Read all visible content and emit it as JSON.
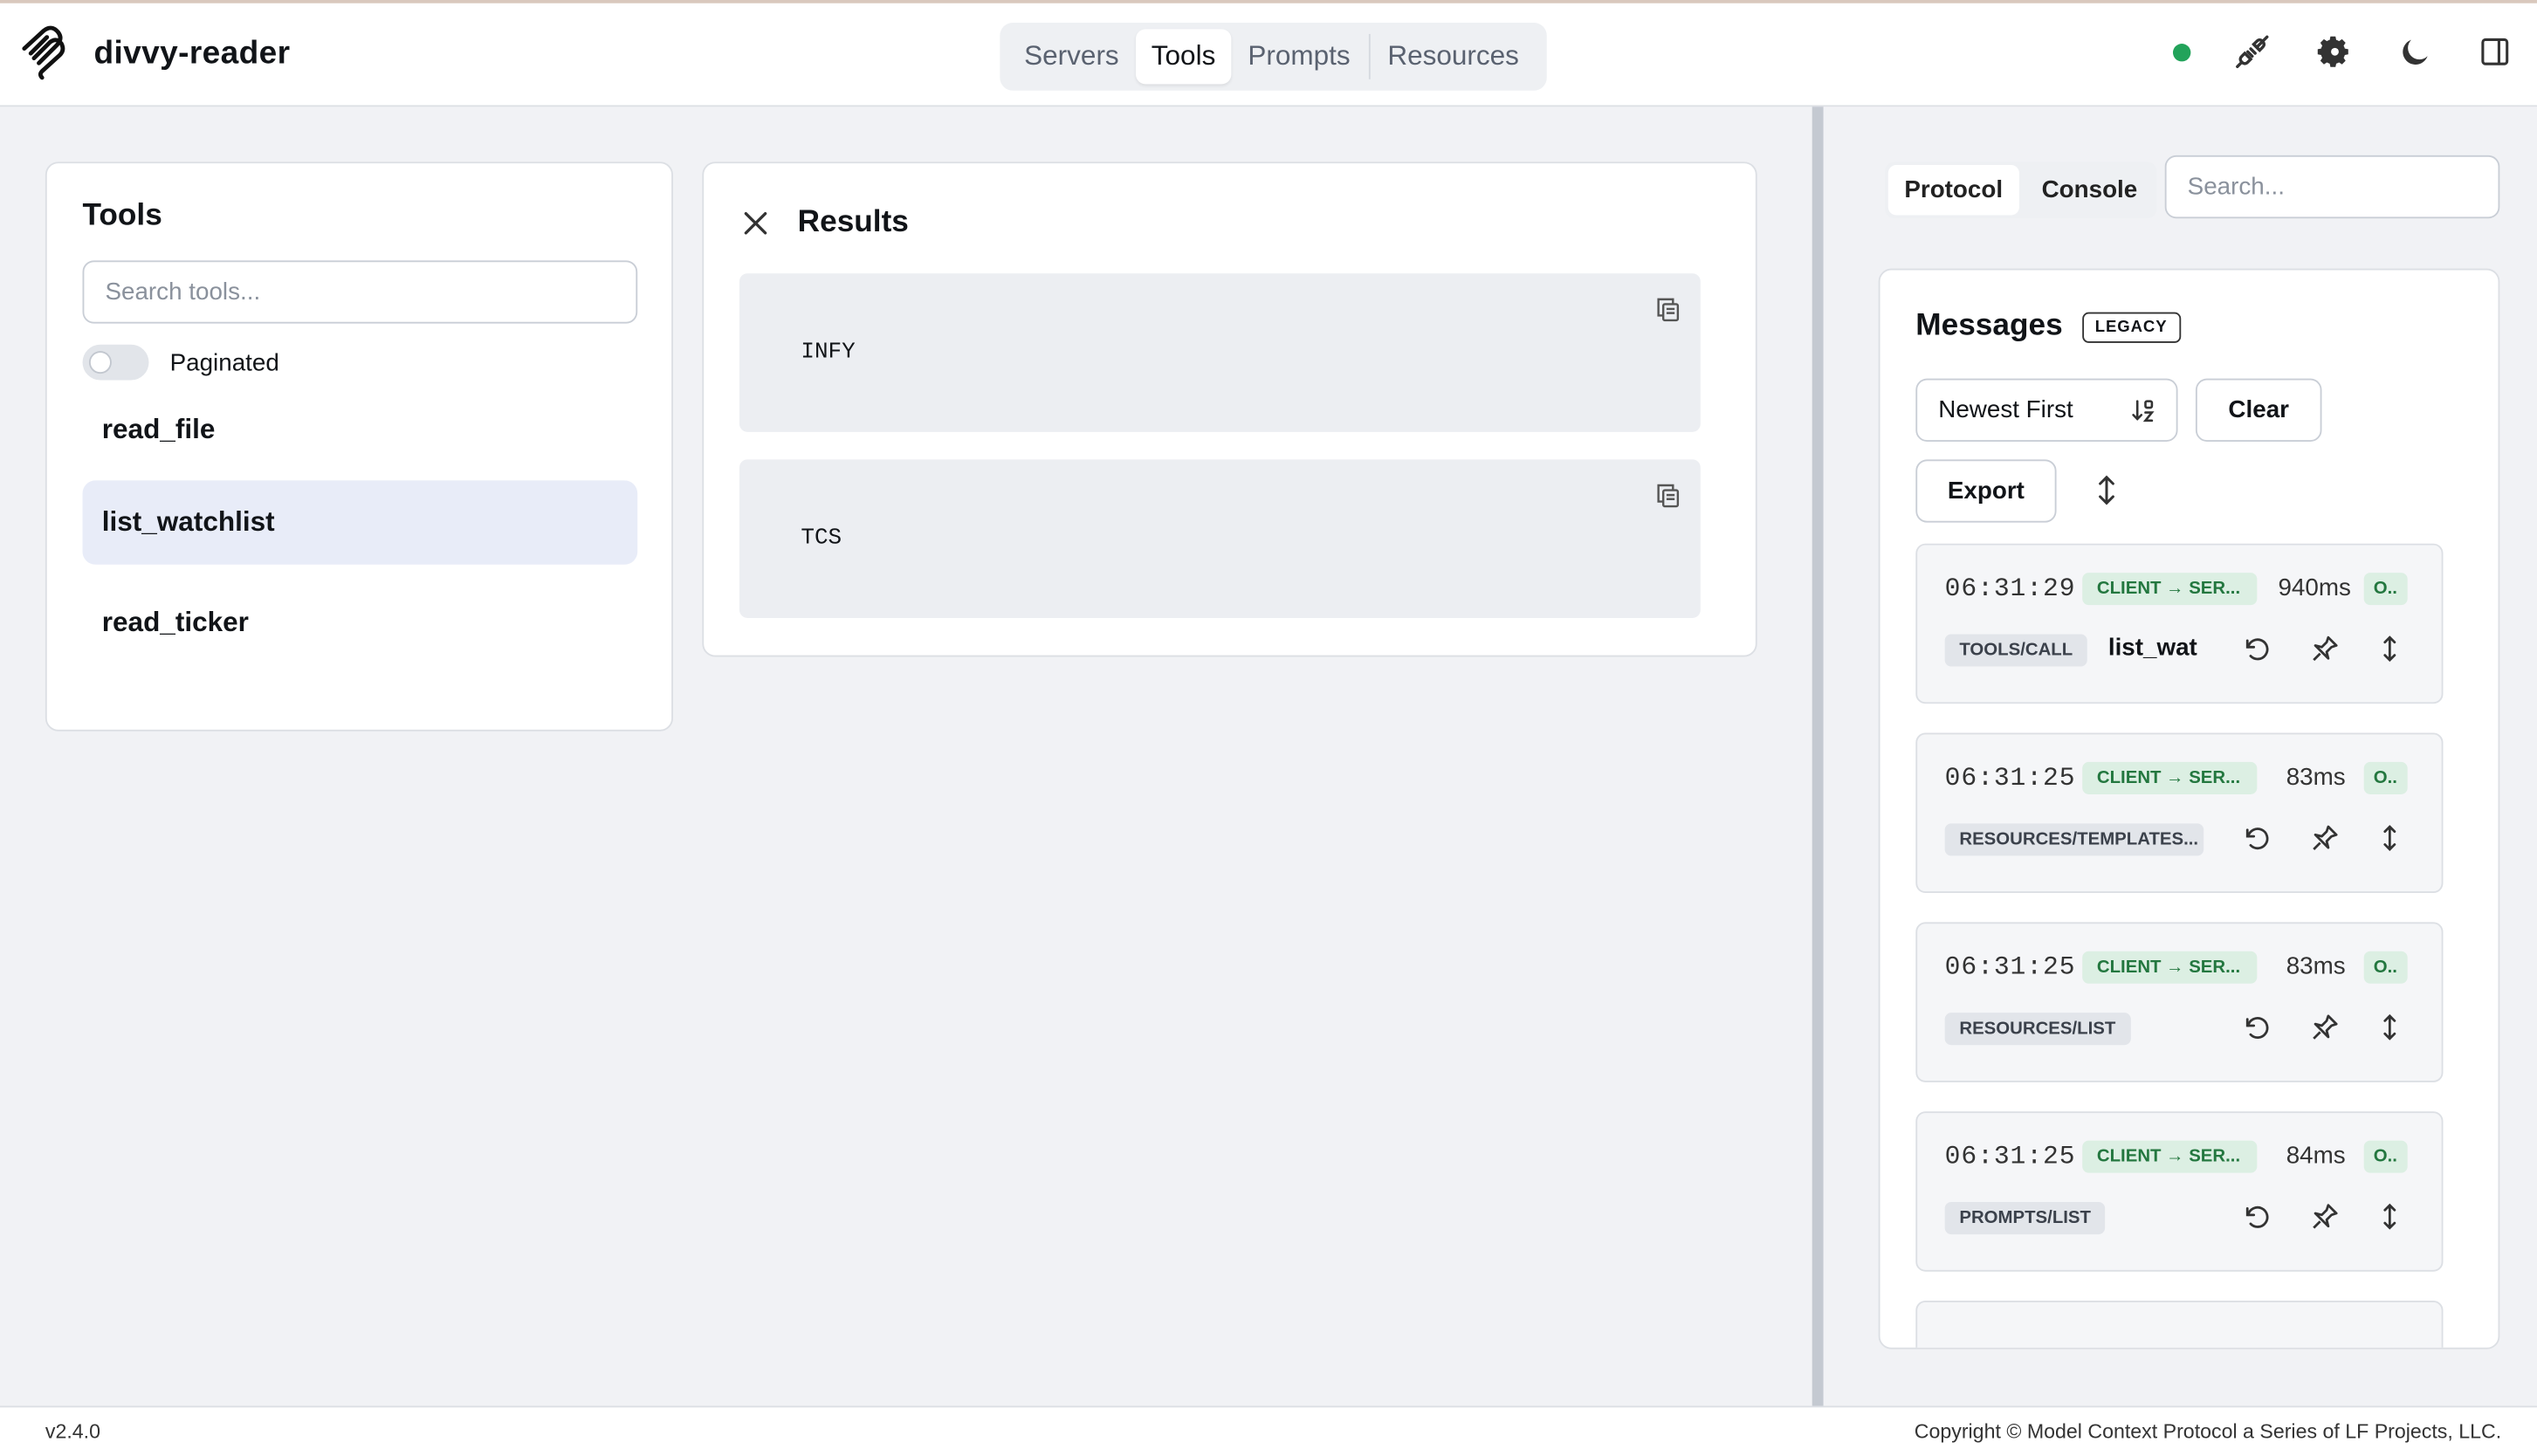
{
  "app": {
    "name": "divvy-reader",
    "version": "v2.4.0",
    "copyright": "Copyright © Model Context Protocol a Series of LF Projects, LLC."
  },
  "nav": {
    "tabs": [
      "Servers",
      "Tools",
      "Prompts",
      "Resources"
    ],
    "active": "Tools"
  },
  "header_icons": [
    "status-connected-dot",
    "plug-icon",
    "gear-icon",
    "moon-icon",
    "panel-toggle-icon"
  ],
  "colors": {
    "status_connected": "#22a35a",
    "active_item_bg": "#e8ecf8",
    "badge_green_bg": "#dcefe3",
    "badge_green_text": "#23773f"
  },
  "tools_panel": {
    "title": "Tools",
    "search_placeholder": "Search tools...",
    "paginated_label": "Paginated",
    "paginated": false,
    "items": [
      "read_file",
      "list_watchlist",
      "read_ticker"
    ],
    "selected": "list_watchlist"
  },
  "results_panel": {
    "title": "Results",
    "items": [
      "INFY",
      "TCS"
    ]
  },
  "right_panel": {
    "tabs": [
      "Protocol",
      "Console"
    ],
    "active_tab": "Protocol",
    "search_placeholder": "Search...",
    "messages_title": "Messages",
    "legacy_badge": "LEGACY",
    "sort_value": "Newest First",
    "clear_label": "Clear",
    "export_label": "Export",
    "messages": [
      {
        "time": "06:31:29",
        "direction": "CLIENT → SER...",
        "duration": "940ms",
        "status": "O..",
        "method": "TOOLS/CALL",
        "name": "list_wat"
      },
      {
        "time": "06:31:25",
        "direction": "CLIENT → SER...",
        "duration": "83ms",
        "status": "O..",
        "method": "RESOURCES/TEMPLATES...",
        "name": ""
      },
      {
        "time": "06:31:25",
        "direction": "CLIENT → SER...",
        "duration": "83ms",
        "status": "O..",
        "method": "RESOURCES/LIST",
        "name": ""
      },
      {
        "time": "06:31:25",
        "direction": "CLIENT → SER...",
        "duration": "84ms",
        "status": "O..",
        "method": "PROMPTS/LIST",
        "name": ""
      }
    ]
  }
}
